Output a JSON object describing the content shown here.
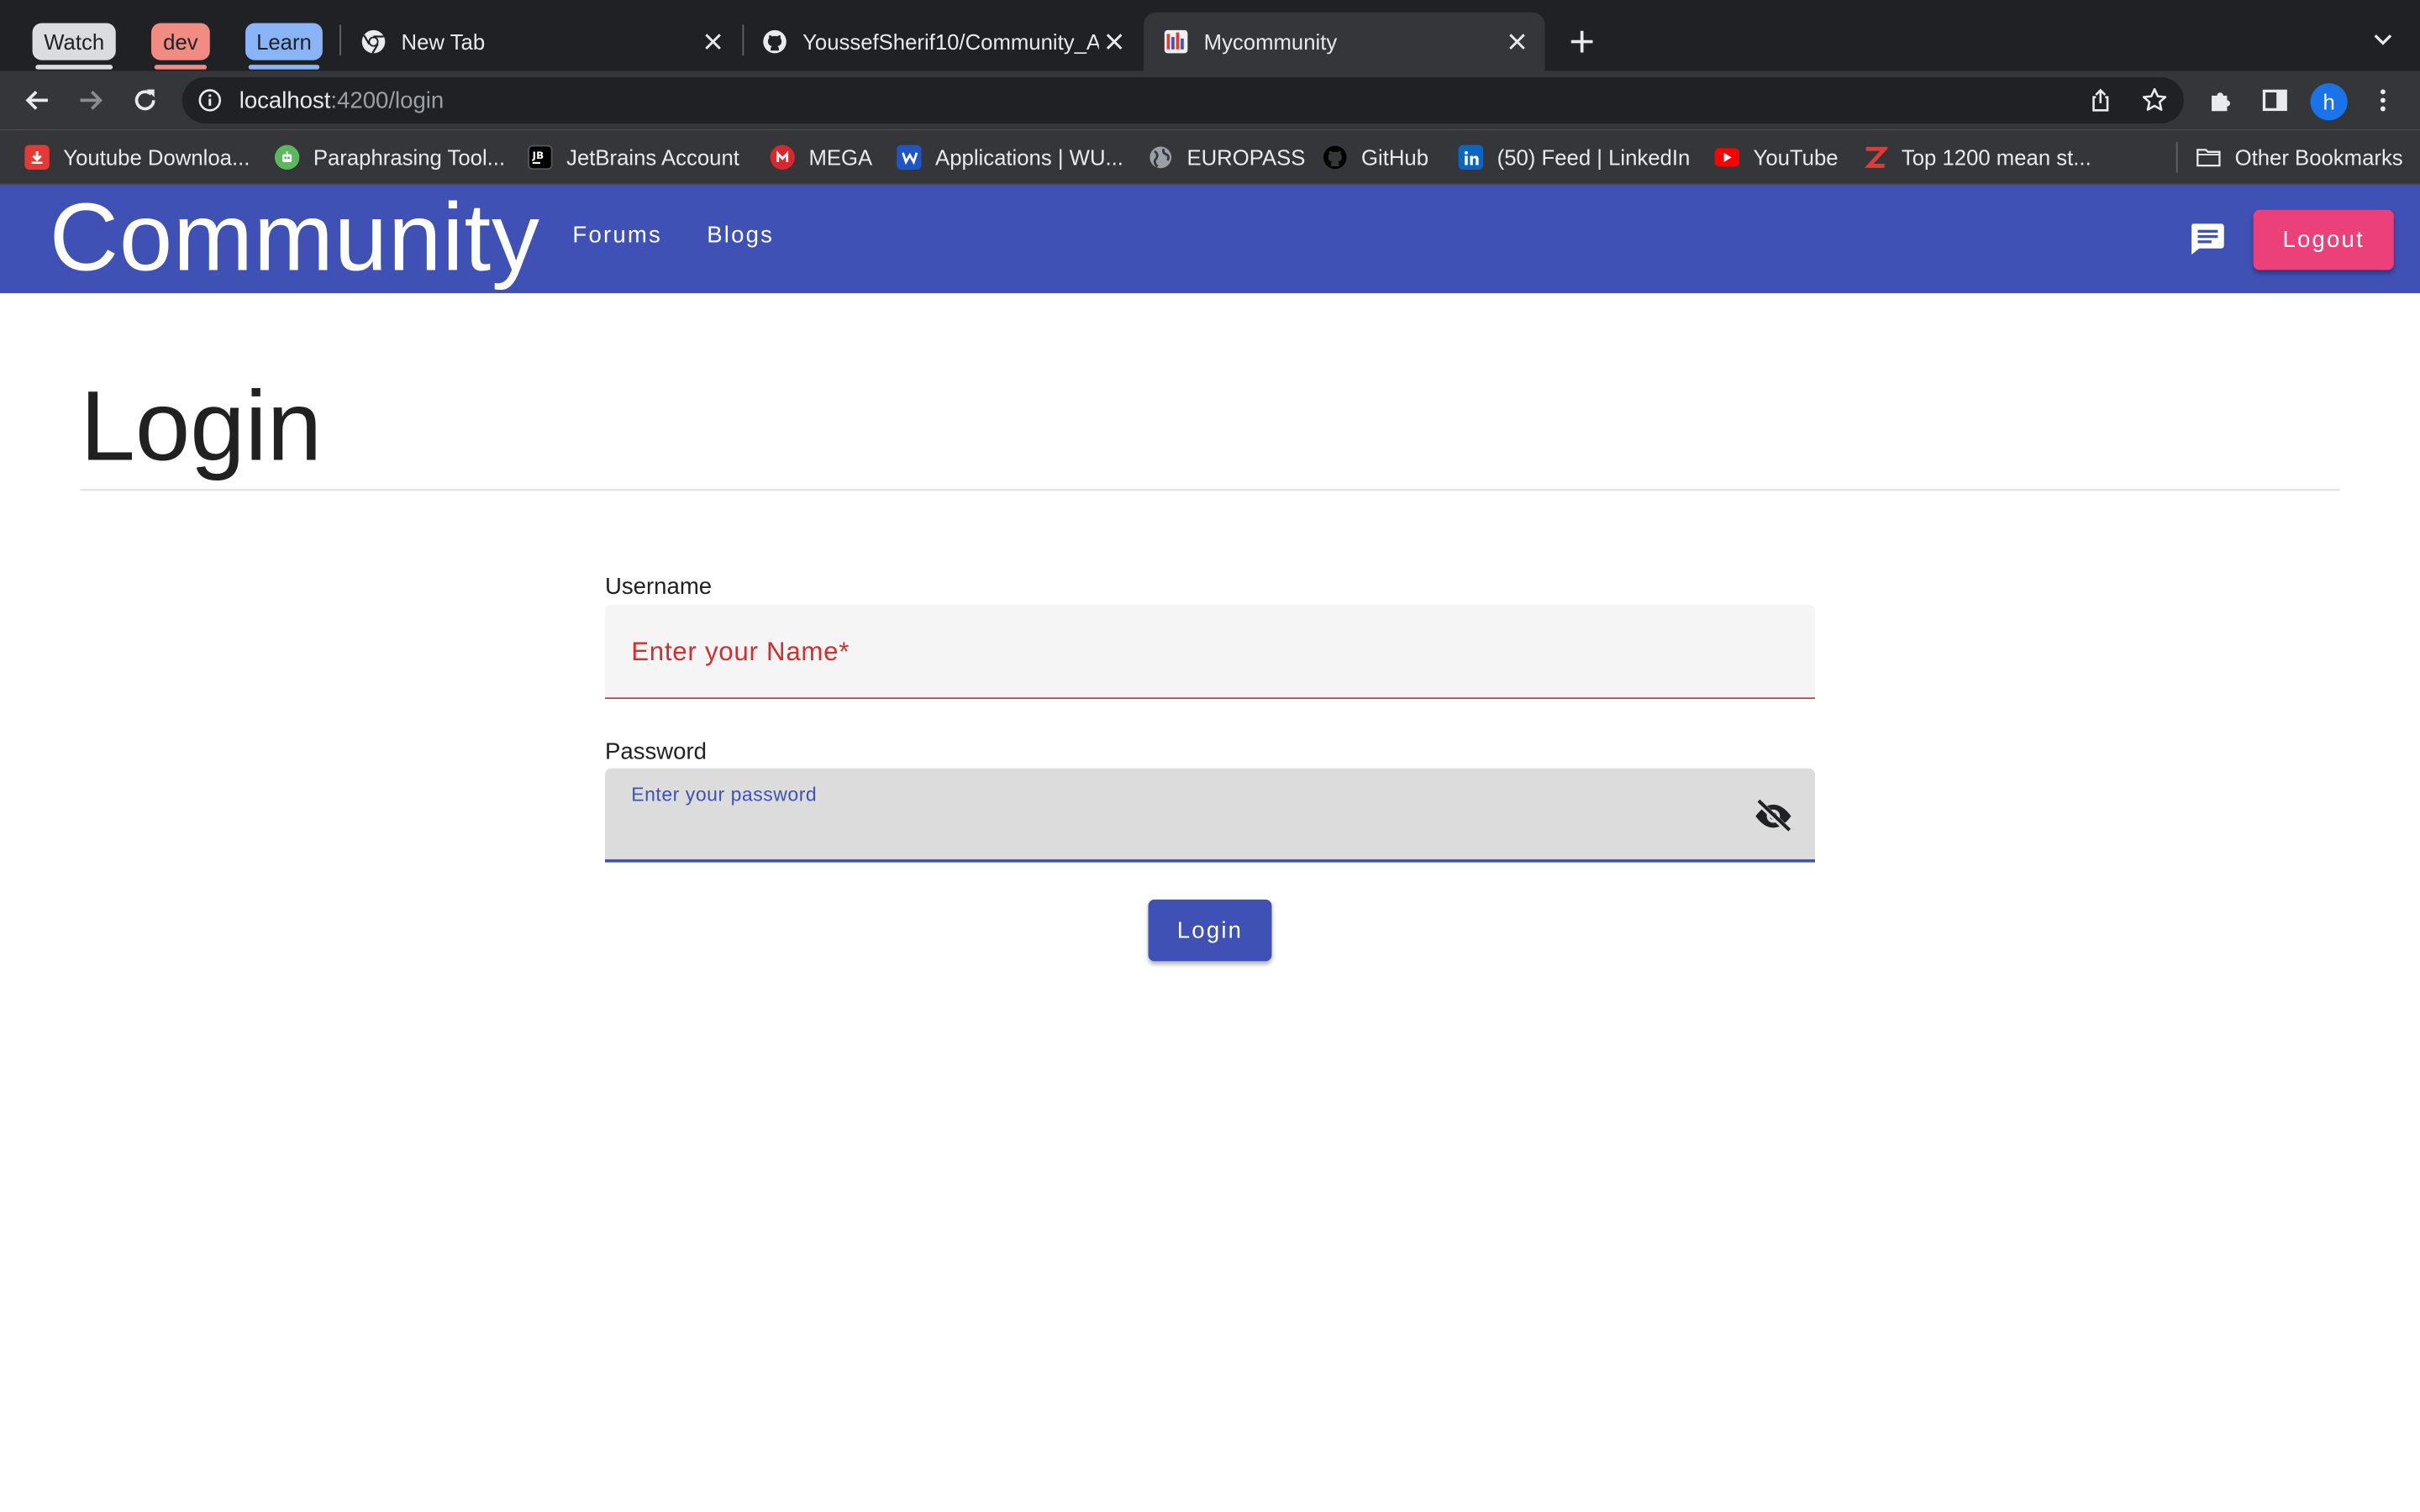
{
  "browser": {
    "tab_groups": [
      {
        "label": "Watch",
        "color": "#dadce0"
      },
      {
        "label": "dev",
        "color": "#f28b82"
      },
      {
        "label": "Learn",
        "color": "#8ab4f8"
      }
    ],
    "tabs": [
      {
        "title": "New Tab",
        "icon": "chrome-icon"
      },
      {
        "title": "YoussefSherif10/Community_A",
        "icon": "github-icon"
      },
      {
        "title": "Mycommunity",
        "icon": "app-favicon",
        "active": true
      }
    ],
    "url": {
      "host": "localhost",
      "rest": ":4200/login"
    },
    "profile_initial": "h",
    "bookmarks": [
      {
        "label": "Youtube Downloa...",
        "icon": "youtube-downloader-icon",
        "color": "#e53935"
      },
      {
        "label": "Paraphrasing Tool...",
        "icon": "robot-icon",
        "color": "#5cb85c"
      },
      {
        "label": "JetBrains Account",
        "icon": "jetbrains-icon",
        "color": "#000000"
      },
      {
        "label": "MEGA",
        "icon": "mega-icon",
        "color": "#d9272e"
      },
      {
        "label": "Applications | WU...",
        "icon": "wu-icon",
        "color": "#1e56c8"
      },
      {
        "label": "EUROPASS",
        "icon": "globe-icon",
        "color": "#9aa0a6"
      },
      {
        "label": "GitHub",
        "icon": "github-icon",
        "color": "#000000"
      },
      {
        "label": "(50) Feed | LinkedIn",
        "icon": "linkedin-icon",
        "color": "#0a66c2"
      },
      {
        "label": "YouTube",
        "icon": "youtube-icon",
        "color": "#ff0000"
      },
      {
        "label": "Top 1200 mean st...",
        "icon": "z-icon",
        "color": "#e53935"
      }
    ],
    "other_bookmarks": "Other Bookmarks"
  },
  "app": {
    "brand": "Community",
    "nav": [
      "Forums",
      "Blogs"
    ],
    "logout_label": "Logout",
    "accent": "#ec407a",
    "primary": "#3f51b5"
  },
  "login": {
    "title": "Login",
    "username_label": "Username",
    "username_placeholder": "Enter your Name*",
    "password_label": "Password",
    "password_placeholder": "Enter your password",
    "submit_label": "Login"
  }
}
